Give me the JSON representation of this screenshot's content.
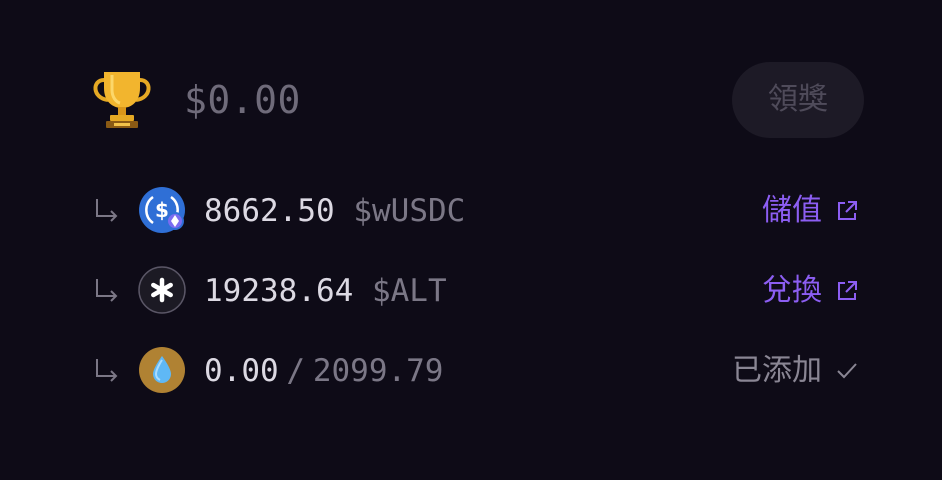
{
  "rewards": {
    "total": "$0.00",
    "claim_label": "領獎"
  },
  "tokens": [
    {
      "icon": "usdc-coin-icon",
      "amount": "8662.50",
      "unit": "$wUSDC",
      "action_label": "儲值",
      "action_icon": "external-link-icon"
    },
    {
      "icon": "alt-asterisk-coin-icon",
      "amount": "19238.64",
      "unit": "$ALT",
      "action_label": "兌換",
      "action_icon": "external-link-icon"
    },
    {
      "icon": "water-drop-coin-icon",
      "amount": "0.00",
      "separator": "/",
      "max_amount": "2099.79",
      "action_label": "已添加",
      "action_icon": "checkmark-icon"
    }
  ],
  "colors": {
    "background": "#0e0b17",
    "accent": "#8c5ef2",
    "muted": "#7b7786",
    "text": "#dcd9e3",
    "button_bg": "#1d1a26"
  }
}
